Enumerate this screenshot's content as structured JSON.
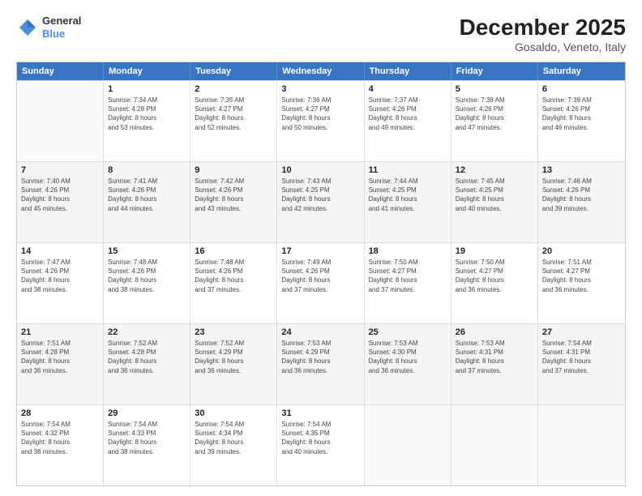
{
  "logo": {
    "line1": "General",
    "line2": "Blue"
  },
  "title": "December 2025",
  "subtitle": "Gosaldo, Veneto, Italy",
  "headers": [
    "Sunday",
    "Monday",
    "Tuesday",
    "Wednesday",
    "Thursday",
    "Friday",
    "Saturday"
  ],
  "weeks": [
    [
      {
        "day": "",
        "info": ""
      },
      {
        "day": "1",
        "info": "Sunrise: 7:34 AM\nSunset: 4:28 PM\nDaylight: 8 hours\nand 53 minutes."
      },
      {
        "day": "2",
        "info": "Sunrise: 7:35 AM\nSunset: 4:27 PM\nDaylight: 8 hours\nand 52 minutes."
      },
      {
        "day": "3",
        "info": "Sunrise: 7:36 AM\nSunset: 4:27 PM\nDaylight: 8 hours\nand 50 minutes."
      },
      {
        "day": "4",
        "info": "Sunrise: 7:37 AM\nSunset: 4:26 PM\nDaylight: 8 hours\nand 49 minutes."
      },
      {
        "day": "5",
        "info": "Sunrise: 7:38 AM\nSunset: 4:26 PM\nDaylight: 8 hours\nand 47 minutes."
      },
      {
        "day": "6",
        "info": "Sunrise: 7:39 AM\nSunset: 4:26 PM\nDaylight: 8 hours\nand 46 minutes."
      }
    ],
    [
      {
        "day": "7",
        "info": "Sunrise: 7:40 AM\nSunset: 4:26 PM\nDaylight: 8 hours\nand 45 minutes."
      },
      {
        "day": "8",
        "info": "Sunrise: 7:41 AM\nSunset: 4:26 PM\nDaylight: 8 hours\nand 44 minutes."
      },
      {
        "day": "9",
        "info": "Sunrise: 7:42 AM\nSunset: 4:26 PM\nDaylight: 8 hours\nand 43 minutes."
      },
      {
        "day": "10",
        "info": "Sunrise: 7:43 AM\nSunset: 4:25 PM\nDaylight: 8 hours\nand 42 minutes."
      },
      {
        "day": "11",
        "info": "Sunrise: 7:44 AM\nSunset: 4:25 PM\nDaylight: 8 hours\nand 41 minutes."
      },
      {
        "day": "12",
        "info": "Sunrise: 7:45 AM\nSunset: 4:25 PM\nDaylight: 8 hours\nand 40 minutes."
      },
      {
        "day": "13",
        "info": "Sunrise: 7:46 AM\nSunset: 4:26 PM\nDaylight: 8 hours\nand 39 minutes."
      }
    ],
    [
      {
        "day": "14",
        "info": "Sunrise: 7:47 AM\nSunset: 4:26 PM\nDaylight: 8 hours\nand 38 minutes."
      },
      {
        "day": "15",
        "info": "Sunrise: 7:48 AM\nSunset: 4:26 PM\nDaylight: 8 hours\nand 38 minutes."
      },
      {
        "day": "16",
        "info": "Sunrise: 7:48 AM\nSunset: 4:26 PM\nDaylight: 8 hours\nand 37 minutes."
      },
      {
        "day": "17",
        "info": "Sunrise: 7:49 AM\nSunset: 4:26 PM\nDaylight: 8 hours\nand 37 minutes."
      },
      {
        "day": "18",
        "info": "Sunrise: 7:50 AM\nSunset: 4:27 PM\nDaylight: 8 hours\nand 37 minutes."
      },
      {
        "day": "19",
        "info": "Sunrise: 7:50 AM\nSunset: 4:27 PM\nDaylight: 8 hours\nand 36 minutes."
      },
      {
        "day": "20",
        "info": "Sunrise: 7:51 AM\nSunset: 4:27 PM\nDaylight: 8 hours\nand 36 minutes."
      }
    ],
    [
      {
        "day": "21",
        "info": "Sunrise: 7:51 AM\nSunset: 4:28 PM\nDaylight: 8 hours\nand 36 minutes."
      },
      {
        "day": "22",
        "info": "Sunrise: 7:52 AM\nSunset: 4:28 PM\nDaylight: 8 hours\nand 36 minutes."
      },
      {
        "day": "23",
        "info": "Sunrise: 7:52 AM\nSunset: 4:29 PM\nDaylight: 8 hours\nand 36 minutes."
      },
      {
        "day": "24",
        "info": "Sunrise: 7:53 AM\nSunset: 4:29 PM\nDaylight: 8 hours\nand 36 minutes."
      },
      {
        "day": "25",
        "info": "Sunrise: 7:53 AM\nSunset: 4:30 PM\nDaylight: 8 hours\nand 36 minutes."
      },
      {
        "day": "26",
        "info": "Sunrise: 7:53 AM\nSunset: 4:31 PM\nDaylight: 8 hours\nand 37 minutes."
      },
      {
        "day": "27",
        "info": "Sunrise: 7:54 AM\nSunset: 4:31 PM\nDaylight: 8 hours\nand 37 minutes."
      }
    ],
    [
      {
        "day": "28",
        "info": "Sunrise: 7:54 AM\nSunset: 4:32 PM\nDaylight: 8 hours\nand 38 minutes."
      },
      {
        "day": "29",
        "info": "Sunrise: 7:54 AM\nSunset: 4:33 PM\nDaylight: 8 hours\nand 38 minutes."
      },
      {
        "day": "30",
        "info": "Sunrise: 7:54 AM\nSunset: 4:34 PM\nDaylight: 8 hours\nand 39 minutes."
      },
      {
        "day": "31",
        "info": "Sunrise: 7:54 AM\nSunset: 4:35 PM\nDaylight: 8 hours\nand 40 minutes."
      },
      {
        "day": "",
        "info": ""
      },
      {
        "day": "",
        "info": ""
      },
      {
        "day": "",
        "info": ""
      }
    ]
  ]
}
